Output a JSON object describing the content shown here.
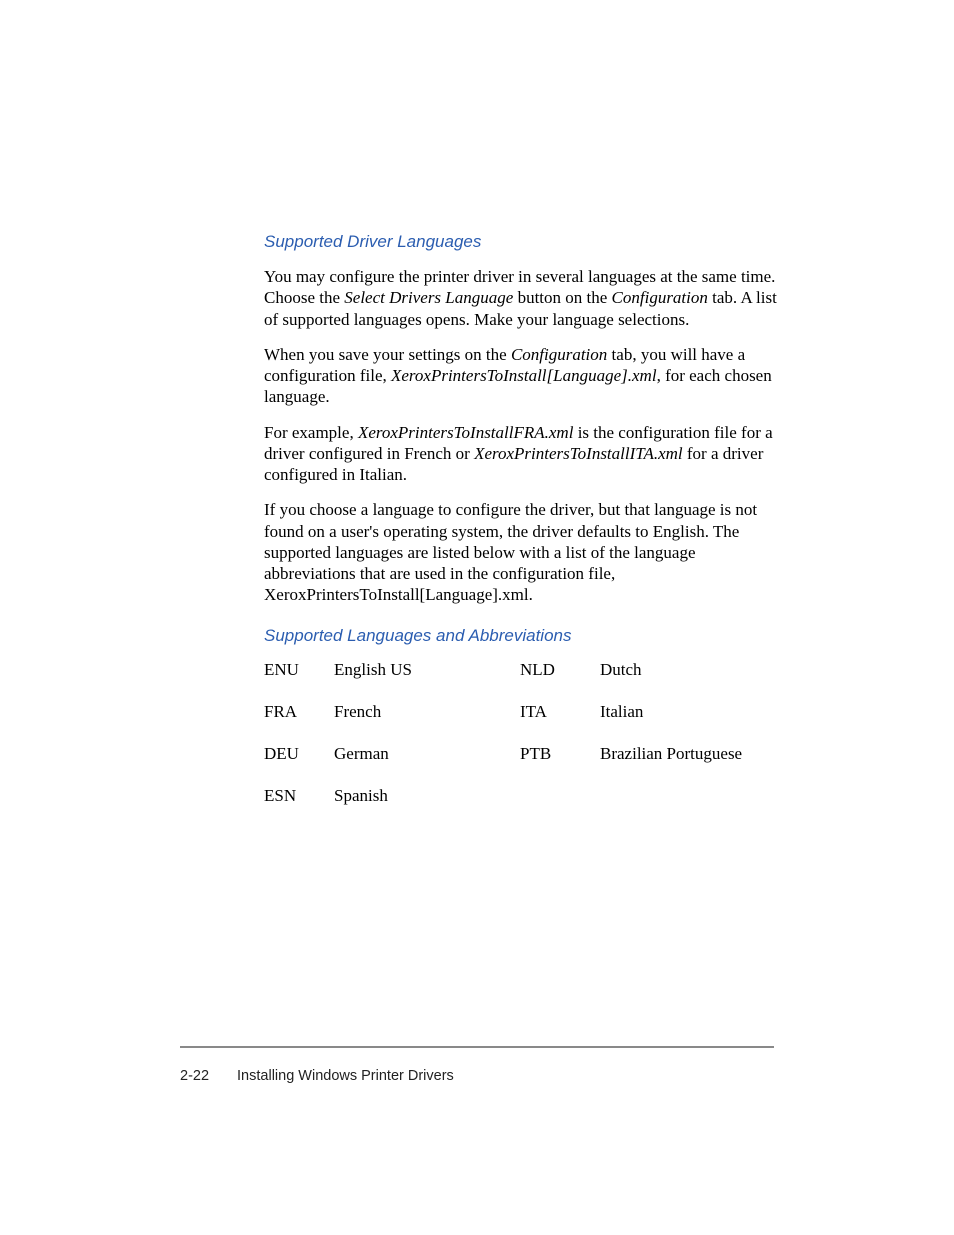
{
  "section1": {
    "heading": "Supported Driver Languages",
    "p1_a": "You may configure the printer driver in several languages at the same time. Choose the ",
    "p1_i1": "Select Drivers Language",
    "p1_b": " button on the ",
    "p1_i2": "Configuration",
    "p1_c": " tab. A list of supported languages opens. Make your language selections.",
    "p2_a": "When you save your settings on the ",
    "p2_i1": "Configuration",
    "p2_b": " tab, you will have a configuration file, ",
    "p2_i2": "XeroxPrintersToInstall[Language].xml",
    "p2_c": ", for each chosen language.",
    "p3_a": "For example, ",
    "p3_i1": "XeroxPrintersToInstallFRA.xml",
    "p3_b": " is the configuration file for a driver configured in French or ",
    "p3_i2": "XeroxPrintersToInstallITA.xml",
    "p3_c": " for a driver configured in Italian.",
    "p4": "If you choose a language to configure the driver, but that language is not found on a user's operating system, the driver defaults to English. The supported languages are listed below with a list of the language abbreviations that are used in the configuration file, XeroxPrintersToInstall[Language].xml."
  },
  "section2": {
    "heading": "Supported Languages and Abbreviations",
    "rows": [
      {
        "abbr1": "ENU",
        "name1": "English US",
        "abbr2": "NLD",
        "name2": "Dutch"
      },
      {
        "abbr1": "FRA",
        "name1": "French",
        "abbr2": "ITA",
        "name2": "Italian"
      },
      {
        "abbr1": "DEU",
        "name1": "German",
        "abbr2": "PTB",
        "name2": "Brazilian Portuguese"
      },
      {
        "abbr1": "ESN",
        "name1": "Spanish",
        "abbr2": "",
        "name2": ""
      }
    ]
  },
  "footer": {
    "page": "2-22",
    "title": "Installing Windows Printer Drivers"
  }
}
